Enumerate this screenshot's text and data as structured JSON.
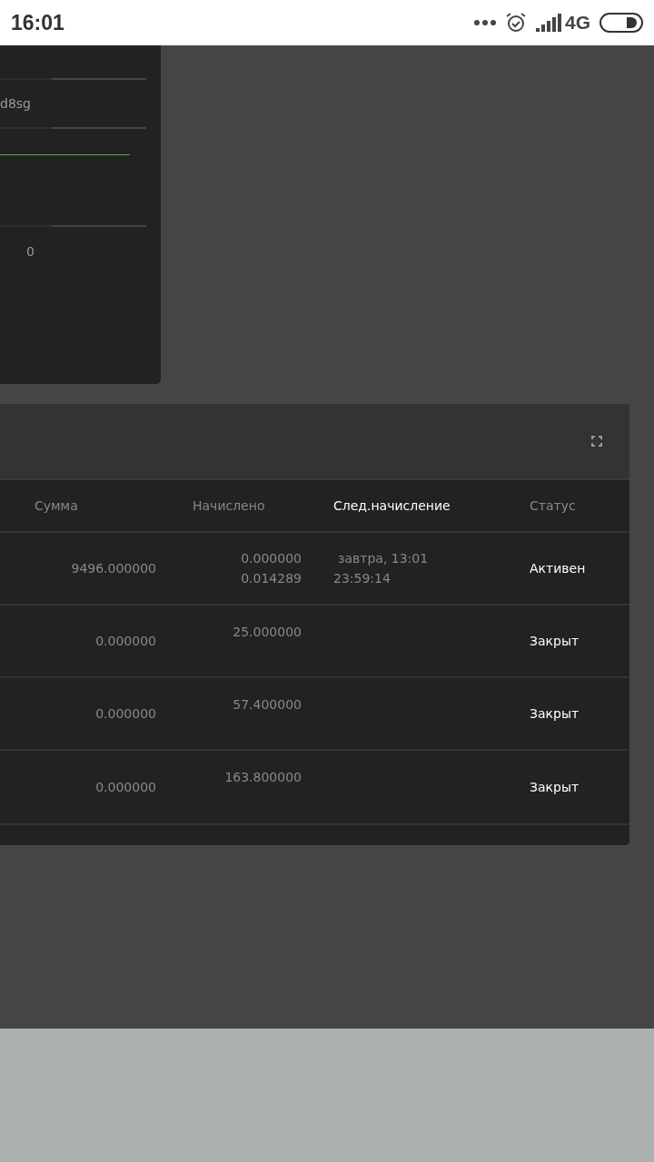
{
  "status_bar": {
    "time": "16:01",
    "network": "4G"
  },
  "top_card": {
    "value_text": "d8sg",
    "count": "0"
  },
  "table": {
    "columns": [
      {
        "label": "Сумма",
        "active": false
      },
      {
        "label": "Начислено",
        "active": false
      },
      {
        "label": "След.начисление",
        "active": true
      },
      {
        "label": "Статус",
        "active": false
      }
    ],
    "rows": [
      {
        "amount": "9496.000000",
        "accrued": [
          "0.000000",
          "0.014289"
        ],
        "next": [
          "завтра, 13:01",
          "23:59:14"
        ],
        "status": "Активен"
      },
      {
        "amount": "0.000000",
        "accrued": [
          "25.000000"
        ],
        "next": [],
        "status": "Закрыт"
      },
      {
        "amount": "0.000000",
        "accrued": [
          "57.400000"
        ],
        "next": [],
        "status": "Закрыт"
      },
      {
        "amount": "0.000000",
        "accrued": [
          "163.800000"
        ],
        "next": [],
        "status": "Закрыт"
      }
    ]
  }
}
